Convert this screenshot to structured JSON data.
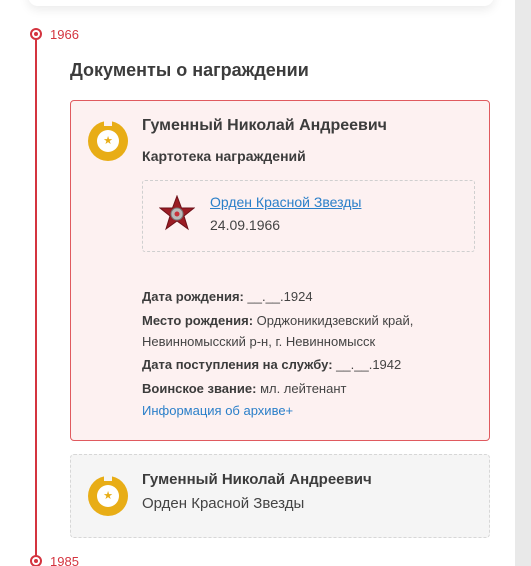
{
  "timeline": {
    "year_top": "1966",
    "year_bottom": "1985"
  },
  "section": {
    "title": "Документы о награждении"
  },
  "award_card": {
    "name": "Гуменный Николай Андреевич",
    "subtitle": "Картотека награждений",
    "order": {
      "title": "Орден Красной Звезды",
      "date": "24.09.1966"
    },
    "birth_date_label": "Дата рождения:",
    "birth_date_value": "__.__.1924",
    "birth_place_label": "Место рождения:",
    "birth_place_value_line1": "Орджоникидзевский край,",
    "birth_place_value_line2": "Невинномысский р-н, г. Невинномысск",
    "service_date_label": "Дата поступления на службу:",
    "service_date_value": "__.__.1942",
    "rank_label": "Воинское звание:",
    "rank_value": "мл. лейтенант",
    "archive_link": "Информация об архиве+"
  },
  "second_card": {
    "name": "Гуменный Николай Андреевич",
    "order": "Орден Красной Звезды"
  },
  "colors": {
    "accent_red": "#d4343f",
    "medal_gold": "#e8ad16",
    "link_blue": "#2a7fc9"
  }
}
